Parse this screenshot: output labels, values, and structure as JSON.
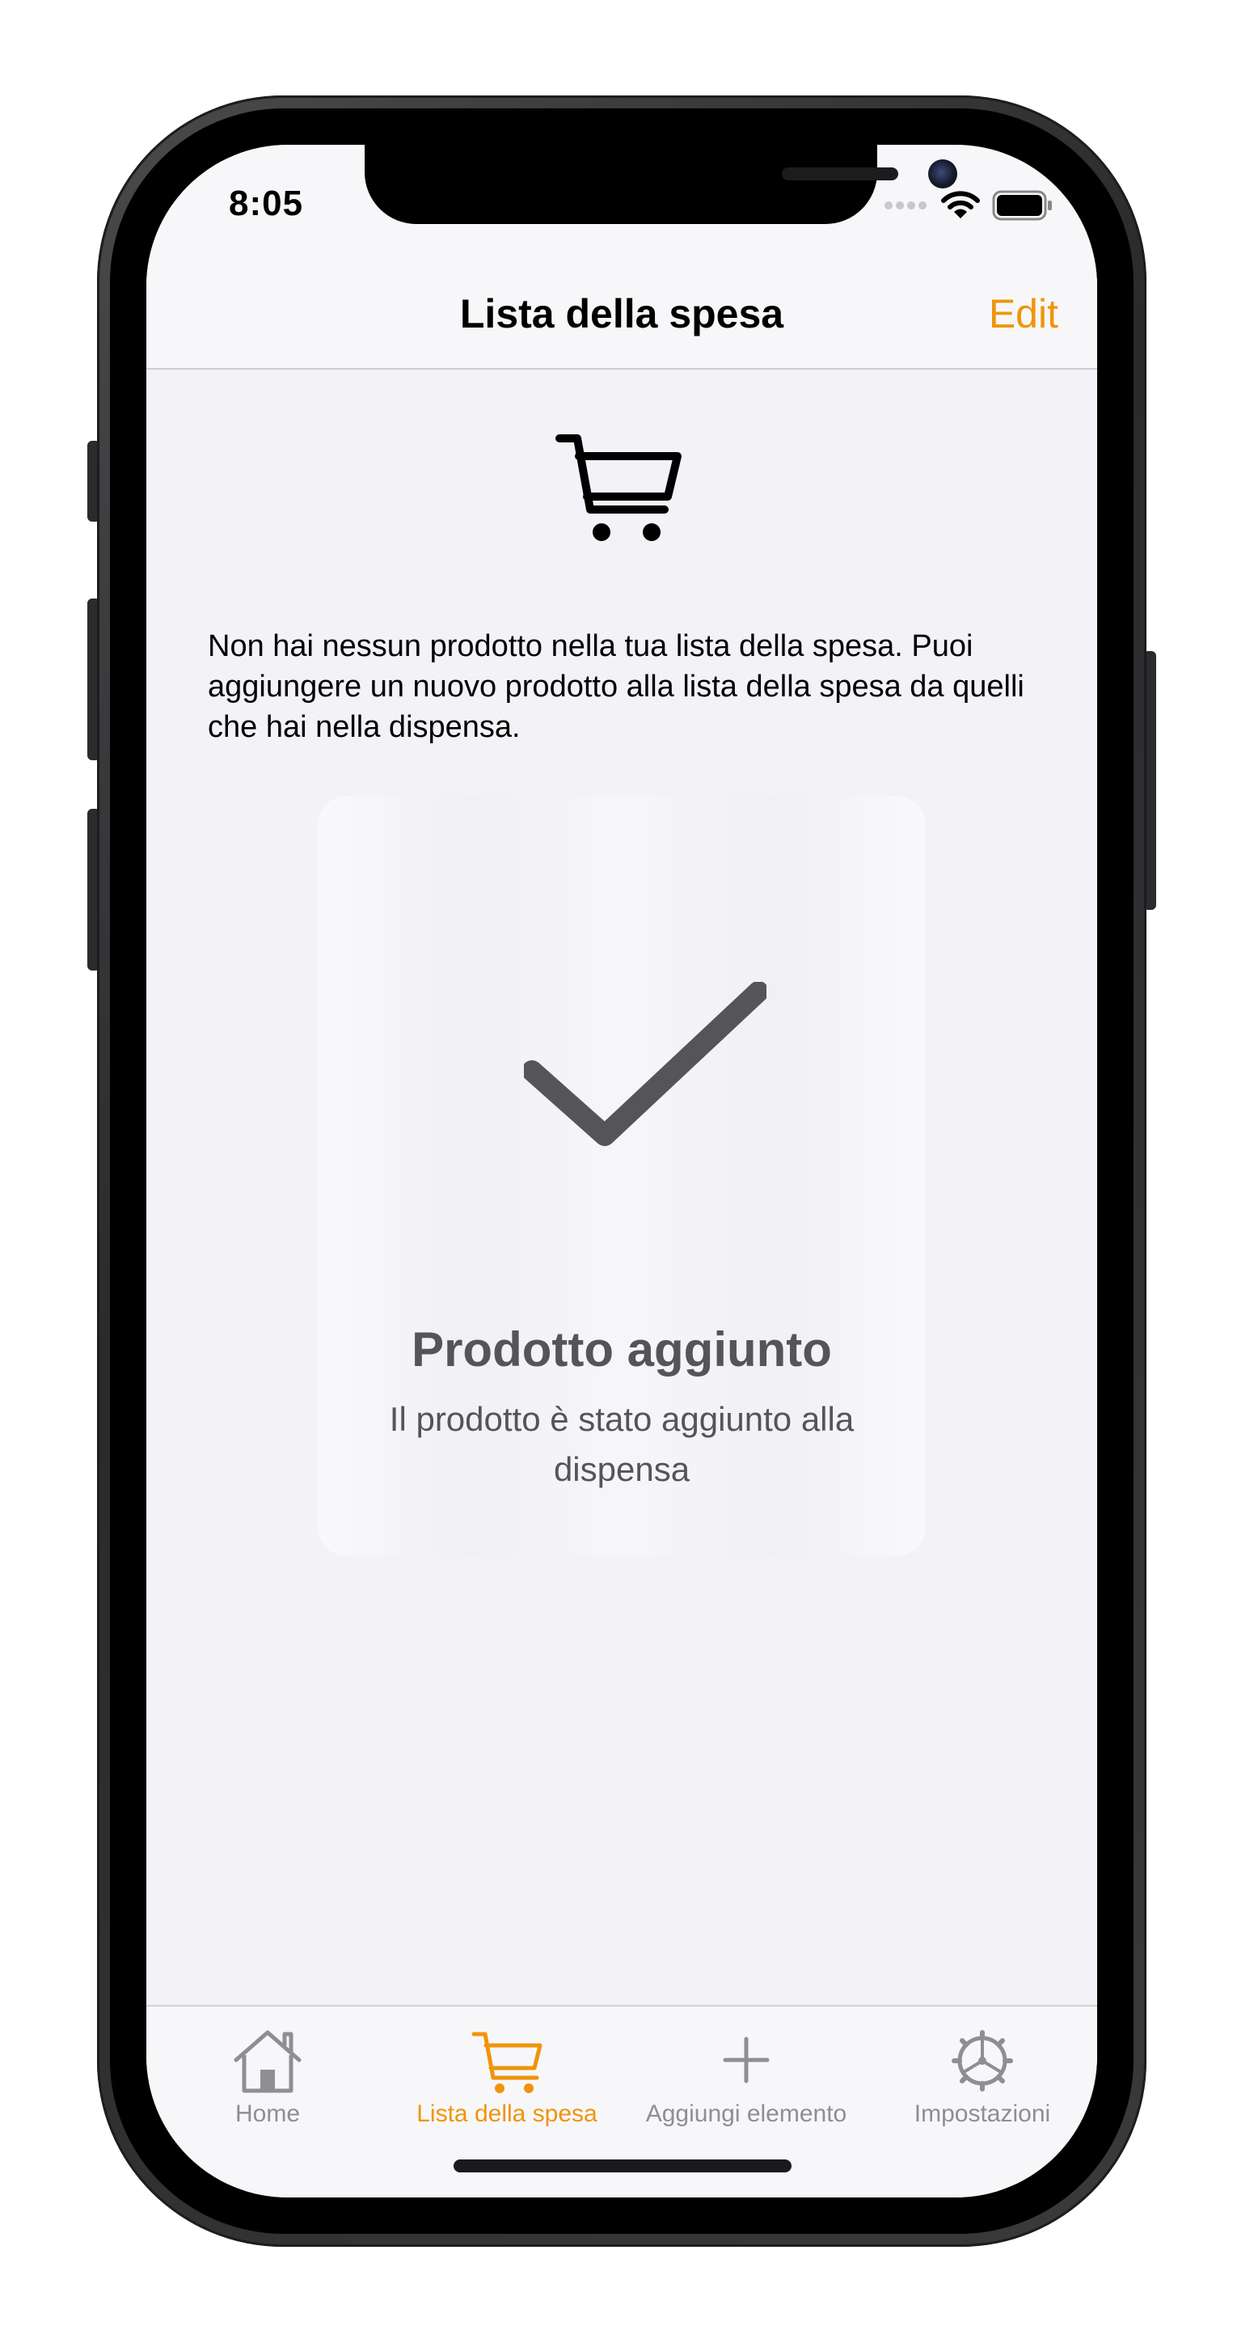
{
  "status_bar": {
    "time": "8:05"
  },
  "nav": {
    "title": "Lista della spesa",
    "edit_label": "Edit"
  },
  "content": {
    "hero_icon": "shopping-cart-icon",
    "empty_message": "Non hai nessun prodotto nella tua lista della spesa. Puoi aggiungere un nuovo prodotto alla lista della spesa da quelli che hai nella dispensa."
  },
  "hud": {
    "icon": "checkmark-icon",
    "title": "Prodotto aggiunto",
    "message": "Il prodotto è stato aggiunto alla dispensa"
  },
  "tabs": [
    {
      "label": "Home",
      "icon": "house-icon",
      "active": false
    },
    {
      "label": "Lista della spesa",
      "icon": "cart-icon",
      "active": true
    },
    {
      "label": "Aggiungi elemento",
      "icon": "plus-icon",
      "active": false
    },
    {
      "label": "Impostazioni",
      "icon": "gear-icon",
      "active": false
    }
  ],
  "colors": {
    "accent": "#f0940a",
    "inactive": "#8e8e93",
    "background": "#f2f2f7",
    "hud_text": "#555558"
  }
}
